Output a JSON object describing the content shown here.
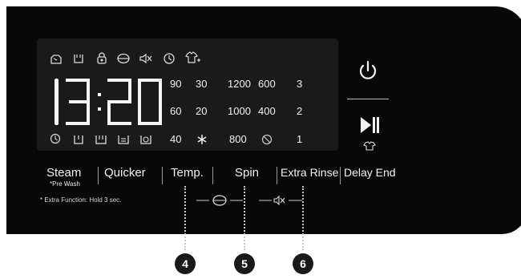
{
  "display": {
    "time_hours": "13",
    "time_minutes": "20",
    "temperature_values": [
      "90",
      "30",
      "60",
      "20",
      "40"
    ],
    "spin_values": [
      "1200",
      "600",
      "1000",
      "400",
      "800"
    ],
    "rinse_values": [
      "3",
      "2",
      "1"
    ],
    "top_icons": [
      "door-lock-steam-icon",
      "water-basin-icon",
      "child-lock-icon",
      "eco-drum-icon",
      "mute-icon",
      "timer-icon",
      "shirt-plus-icon"
    ],
    "bottom_icons": [
      "clock-icon",
      "basin-icon",
      "double-basin-icon",
      "prewash-icon",
      "steam-basin-icon",
      "snowflake-icon",
      "no-spin-icon"
    ]
  },
  "buttons": [
    {
      "label": "Steam",
      "sub": "*Pre Wash"
    },
    {
      "label": "Quicker"
    },
    {
      "label": "Temp."
    },
    {
      "label": "Spin"
    },
    {
      "label": "Extra Rinse"
    },
    {
      "label": "Delay End"
    }
  ],
  "side_buttons": [
    "power-icon",
    "play-pause-icon",
    "shirt-icon"
  ],
  "extra_function_note": "* Extra Function: Hold 3 sec.",
  "markers": [
    "4",
    "5",
    "6"
  ],
  "colors": {
    "panel": "#080808",
    "lcd": "#1a1a1a",
    "text": "#f2f2f2",
    "marker": "#1a1a1a"
  }
}
